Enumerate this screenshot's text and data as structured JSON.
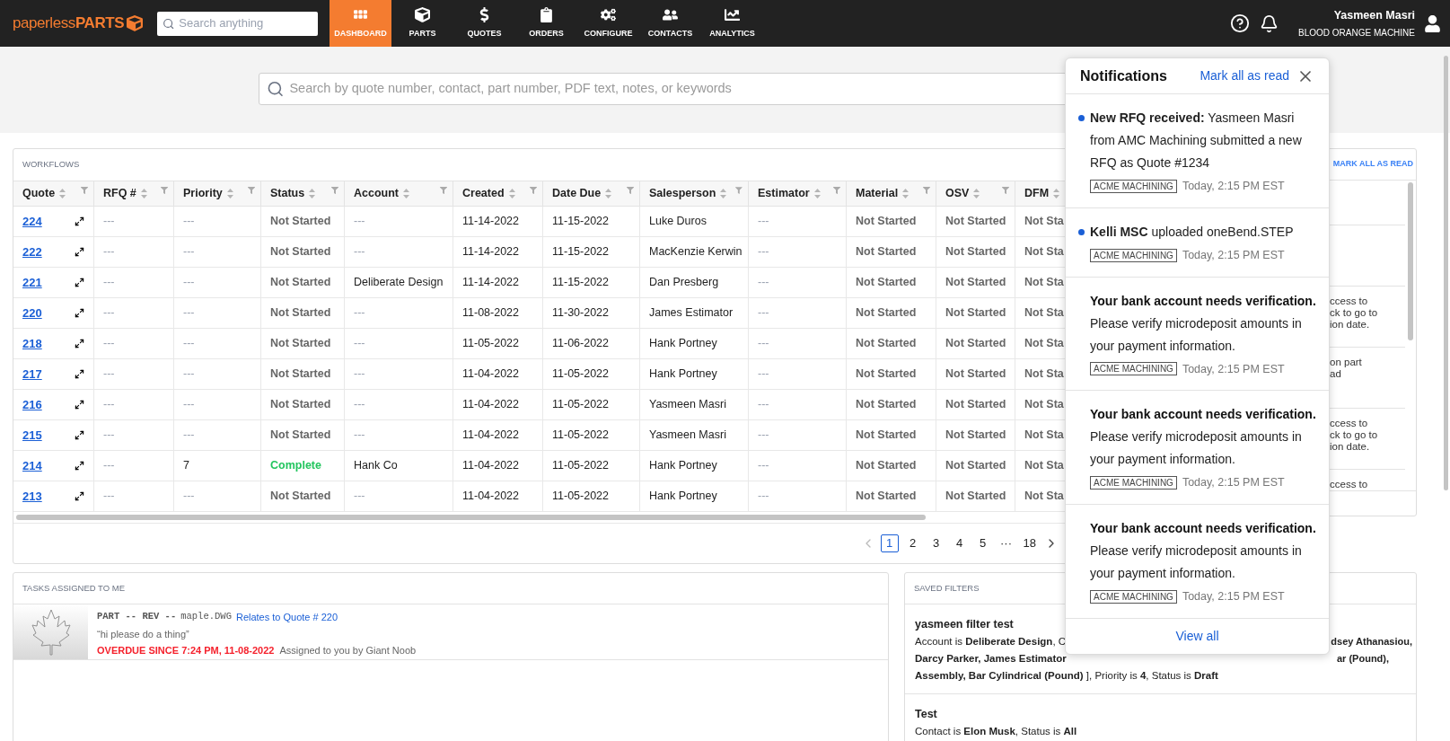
{
  "top_bar": {
    "logo": "paperless**PARTS**",
    "search": {
      "placeholder": "Search anything"
    },
    "nav": [
      {
        "label": "DASHBOARD",
        "selected": true
      },
      {
        "label": "PARTS",
        "selected": false
      },
      {
        "label": "QUOTES",
        "selected": false
      },
      {
        "label": "ORDERS",
        "selected": false
      },
      {
        "label": "CONFIGURE",
        "selected": false
      },
      {
        "label": "CONTACTS",
        "selected": false
      },
      {
        "label": "ANALYTICS",
        "selected": false
      }
    ],
    "user": {
      "name": "Yasmeen Masri",
      "company": "BLOOD ORANGE MACHINE"
    }
  },
  "search": {
    "placeholder": "Search by quote number, contact, part number, PDF text, notes, or keywords"
  },
  "workflows": {
    "title": "WORKFLOWS",
    "columns": [
      "Quote",
      "RFQ #",
      "Priority",
      "Status",
      "Account",
      "Created",
      "Date Due",
      "Salesperson",
      "Estimator",
      "Material",
      "OSV",
      "DFM"
    ],
    "rows": [
      {
        "cells": [
          {
            "text": "224",
            "kind": "link"
          },
          {
            "text": "---",
            "kind": "empty"
          },
          {
            "text": "---",
            "kind": "empty"
          },
          {
            "text": "Not Started",
            "kind": "pending"
          },
          {
            "text": "---",
            "kind": "empty"
          },
          {
            "text": "11-14-2022"
          },
          {
            "text": "11-15-2022"
          },
          {
            "text": "Luke Duros"
          },
          {
            "text": "---",
            "kind": "empty"
          },
          {
            "text": "Not Started",
            "kind": "pending"
          },
          {
            "text": "Not Started",
            "kind": "pending"
          },
          {
            "text": "Not Sta",
            "kind": "pending"
          }
        ]
      },
      {
        "cells": [
          {
            "text": "222",
            "kind": "link"
          },
          {
            "text": "---",
            "kind": "empty"
          },
          {
            "text": "---",
            "kind": "empty"
          },
          {
            "text": "Not Started",
            "kind": "pending"
          },
          {
            "text": "---",
            "kind": "empty"
          },
          {
            "text": "11-14-2022"
          },
          {
            "text": "11-15-2022"
          },
          {
            "text": "MacKenzie Kerwin"
          },
          {
            "text": "---",
            "kind": "empty"
          },
          {
            "text": "Not Started",
            "kind": "pending"
          },
          {
            "text": "Not Started",
            "kind": "pending"
          },
          {
            "text": "Not Sta",
            "kind": "pending"
          }
        ]
      },
      {
        "cells": [
          {
            "text": "221",
            "kind": "link"
          },
          {
            "text": "---",
            "kind": "empty"
          },
          {
            "text": "---",
            "kind": "empty"
          },
          {
            "text": "Not Started",
            "kind": "pending"
          },
          {
            "text": "Deliberate Design"
          },
          {
            "text": "11-14-2022"
          },
          {
            "text": "11-15-2022"
          },
          {
            "text": "Dan Presberg"
          },
          {
            "text": "---",
            "kind": "empty"
          },
          {
            "text": "Not Started",
            "kind": "pending"
          },
          {
            "text": "Not Started",
            "kind": "pending"
          },
          {
            "text": "Not Sta",
            "kind": "pending"
          }
        ]
      },
      {
        "cells": [
          {
            "text": "220",
            "kind": "link"
          },
          {
            "text": "---",
            "kind": "empty"
          },
          {
            "text": "---",
            "kind": "empty"
          },
          {
            "text": "Not Started",
            "kind": "pending"
          },
          {
            "text": "---",
            "kind": "empty"
          },
          {
            "text": "11-08-2022"
          },
          {
            "text": "11-30-2022"
          },
          {
            "text": "James Estimator"
          },
          {
            "text": "---",
            "kind": "empty"
          },
          {
            "text": "Not Started",
            "kind": "pending"
          },
          {
            "text": "Not Started",
            "kind": "pending"
          },
          {
            "text": "Not Sta",
            "kind": "pending"
          }
        ]
      },
      {
        "cells": [
          {
            "text": "218",
            "kind": "link"
          },
          {
            "text": "---",
            "kind": "empty"
          },
          {
            "text": "---",
            "kind": "empty"
          },
          {
            "text": "Not Started",
            "kind": "pending"
          },
          {
            "text": "---",
            "kind": "empty"
          },
          {
            "text": "11-05-2022"
          },
          {
            "text": "11-06-2022"
          },
          {
            "text": "Hank Portney"
          },
          {
            "text": "---",
            "kind": "empty"
          },
          {
            "text": "Not Started",
            "kind": "pending"
          },
          {
            "text": "Not Started",
            "kind": "pending"
          },
          {
            "text": "Not Sta",
            "kind": "pending"
          }
        ]
      },
      {
        "cells": [
          {
            "text": "217",
            "kind": "link"
          },
          {
            "text": "---",
            "kind": "empty"
          },
          {
            "text": "---",
            "kind": "empty"
          },
          {
            "text": "Not Started",
            "kind": "pending"
          },
          {
            "text": "---",
            "kind": "empty"
          },
          {
            "text": "11-04-2022"
          },
          {
            "text": "11-05-2022"
          },
          {
            "text": "Hank Portney"
          },
          {
            "text": "---",
            "kind": "empty"
          },
          {
            "text": "Not Started",
            "kind": "pending"
          },
          {
            "text": "Not Started",
            "kind": "pending"
          },
          {
            "text": "Not Sta",
            "kind": "pending"
          }
        ]
      },
      {
        "cells": [
          {
            "text": "216",
            "kind": "link"
          },
          {
            "text": "---",
            "kind": "empty"
          },
          {
            "text": "---",
            "kind": "empty"
          },
          {
            "text": "Not Started",
            "kind": "pending"
          },
          {
            "text": "---",
            "kind": "empty"
          },
          {
            "text": "11-04-2022"
          },
          {
            "text": "11-05-2022"
          },
          {
            "text": "Yasmeen Masri"
          },
          {
            "text": "---",
            "kind": "empty"
          },
          {
            "text": "Not Started",
            "kind": "pending"
          },
          {
            "text": "Not Started",
            "kind": "pending"
          },
          {
            "text": "Not Sta",
            "kind": "pending"
          }
        ]
      },
      {
        "cells": [
          {
            "text": "215",
            "kind": "link"
          },
          {
            "text": "---",
            "kind": "empty"
          },
          {
            "text": "---",
            "kind": "empty"
          },
          {
            "text": "Not Started",
            "kind": "pending"
          },
          {
            "text": "---",
            "kind": "empty"
          },
          {
            "text": "11-04-2022"
          },
          {
            "text": "11-05-2022"
          },
          {
            "text": "Yasmeen Masri"
          },
          {
            "text": "---",
            "kind": "empty"
          },
          {
            "text": "Not Started",
            "kind": "pending"
          },
          {
            "text": "Not Started",
            "kind": "pending"
          },
          {
            "text": "Not Sta",
            "kind": "pending"
          }
        ]
      },
      {
        "cells": [
          {
            "text": "214",
            "kind": "link"
          },
          {
            "text": "---",
            "kind": "empty"
          },
          {
            "text": "7"
          },
          {
            "text": "Complete",
            "kind": "done"
          },
          {
            "text": "Hank Co"
          },
          {
            "text": "11-04-2022"
          },
          {
            "text": "11-05-2022"
          },
          {
            "text": "Hank Portney"
          },
          {
            "text": "---",
            "kind": "empty"
          },
          {
            "text": "Not Started",
            "kind": "pending"
          },
          {
            "text": "Not Started",
            "kind": "pending"
          },
          {
            "text": "Not Sta",
            "kind": "pending"
          }
        ]
      },
      {
        "cells": [
          {
            "text": "213",
            "kind": "link"
          },
          {
            "text": "---",
            "kind": "empty"
          },
          {
            "text": "---",
            "kind": "empty"
          },
          {
            "text": "Not Started",
            "kind": "pending"
          },
          {
            "text": "---",
            "kind": "empty"
          },
          {
            "text": "11-04-2022"
          },
          {
            "text": "11-05-2022"
          },
          {
            "text": "Hank Portney"
          },
          {
            "text": "---",
            "kind": "empty"
          },
          {
            "text": "Not Started",
            "kind": "pending"
          },
          {
            "text": "Not Started",
            "kind": "pending"
          },
          {
            "text": "Not Sta",
            "kind": "pending"
          }
        ]
      }
    ],
    "pagination": [
      {
        "label": "1",
        "selected": true
      },
      {
        "label": "2",
        "selected": false
      },
      {
        "label": "3",
        "selected": false
      },
      {
        "label": "4",
        "selected": false
      },
      {
        "label": "5",
        "selected": false
      },
      {
        "label": "···",
        "selected": false
      },
      {
        "label": "18",
        "selected": false
      }
    ]
  },
  "activity": {
    "action": "MARK ALL AS READ",
    "rows": [
      {
        "lines": [
          "ccess to",
          "ck to go to",
          "ion date."
        ]
      },
      {
        "lines": [
          "on part",
          "ad"
        ]
      },
      {
        "lines": [
          "ccess to",
          "ck to go to",
          "ion date."
        ]
      },
      {
        "lines": [
          "ccess to"
        ]
      }
    ]
  },
  "tasks": {
    "title": "TASKS ASSIGNED TO ME",
    "items": [
      {
        "part": "PART -- REV --",
        "file": "maple.DWG",
        "link": "Relates to Quote # 220",
        "note": "“hi please do a thing”",
        "overdue": "OVERDUE SINCE 7:24 PM, 11-08-2022",
        "assigned": "Assigned to you by Giant Noob"
      }
    ]
  },
  "saved_filters": {
    "title": "SAVED FILTERS",
    "filters": [
      {
        "name": "yasmeen filter test",
        "lines": [
          {
            "left": "Account is **Deliberate Design**, C",
            "right": "dsey Athanasiou,"
          },
          {
            "left": "**Darcy Parker, James Estimator**",
            "right": "ar (Pound),"
          },
          {
            "left": "**Assembly, Bar Cylindrical (Pound)** ], Priority is **4**, Status is **Draft**"
          }
        ]
      },
      {
        "name": "Test",
        "lines": [
          {
            "left": "Contact is **Elon Musk**, Status is **All**"
          }
        ]
      }
    ]
  },
  "notifications": {
    "title": "Notifications",
    "mark_all": "Mark all as read",
    "view_all": "View all",
    "items": [
      {
        "kind": "inline",
        "unread": true,
        "title": "New RFQ received:",
        "body": "Yasmeen Masri from AMC Machining submitted a new RFQ as Quote #1234",
        "tag": "ACME MACHINING",
        "time": "Today, 2:15 PM EST"
      },
      {
        "kind": "inline",
        "unread": true,
        "title": "Kelli MSC",
        "body": "uploaded oneBend.STEP",
        "tag": "ACME MACHINING",
        "time": "Today, 2:15 PM EST"
      },
      {
        "kind": "block",
        "unread": false,
        "title": "Your bank account needs verification.",
        "body": "Please verify microdeposit amounts in your payment information.",
        "tag": "ACME MACHINING",
        "time": "Today, 2:15 PM EST"
      },
      {
        "kind": "block",
        "unread": false,
        "title": "Your bank account needs verification.",
        "body": "Please verify microdeposit amounts in your payment information.",
        "tag": "ACME MACHINING",
        "time": "Today, 2:15 PM EST"
      },
      {
        "kind": "block",
        "unread": false,
        "title": "Your bank account needs verification.",
        "body": "Please verify microdeposit amounts in your payment information.",
        "tag": "ACME MACHINING",
        "time": "Today, 2:15 PM EST"
      }
    ]
  }
}
